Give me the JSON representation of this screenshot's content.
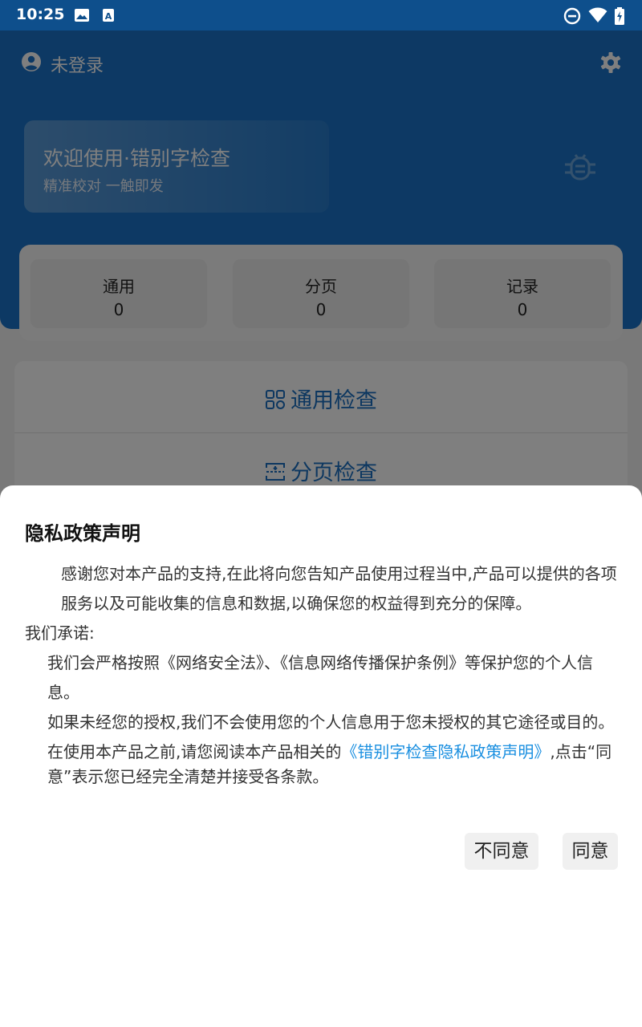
{
  "status_bar": {
    "time": "10:25"
  },
  "toolbar": {
    "user_label": "未登录"
  },
  "welcome": {
    "title": "欢迎使用·错别字检查",
    "subtitle": "精准校对 一触即发"
  },
  "stats": [
    {
      "label": "通用",
      "value": "0"
    },
    {
      "label": "分页",
      "value": "0"
    },
    {
      "label": "记录",
      "value": "0"
    }
  ],
  "actions": {
    "general_check": "通用检查",
    "page_check": "分页检查"
  },
  "dialog": {
    "title": "隐私政策声明",
    "para1": "感谢您对本产品的支持,在此将向您告知产品使用过程当中,产品可以提供的各项服务以及可能收集的信息和数据,以确保您的权益得到充分的保障。",
    "para2": "我们承诺:",
    "para3": "我们会严格按照《网络安全法》、《信息网络传播保护条例》等保护您的个人信息。",
    "para4": "如果未经您的授权,我们不会使用您的个人信息用于您未授权的其它途径或目的。",
    "para5_prefix": "在使用本产品之前,请您阅读本产品相关的",
    "para5_link": "《错别字检查隐私政策声明》",
    "para5_suffix": ",点击“同意”表示您已经完全清楚并接受各条款。",
    "disagree_label": "不同意",
    "agree_label": "同意"
  },
  "colors": {
    "header": "#1a73c8",
    "link": "#1a8fe0",
    "action_text": "#1a6fc0"
  }
}
